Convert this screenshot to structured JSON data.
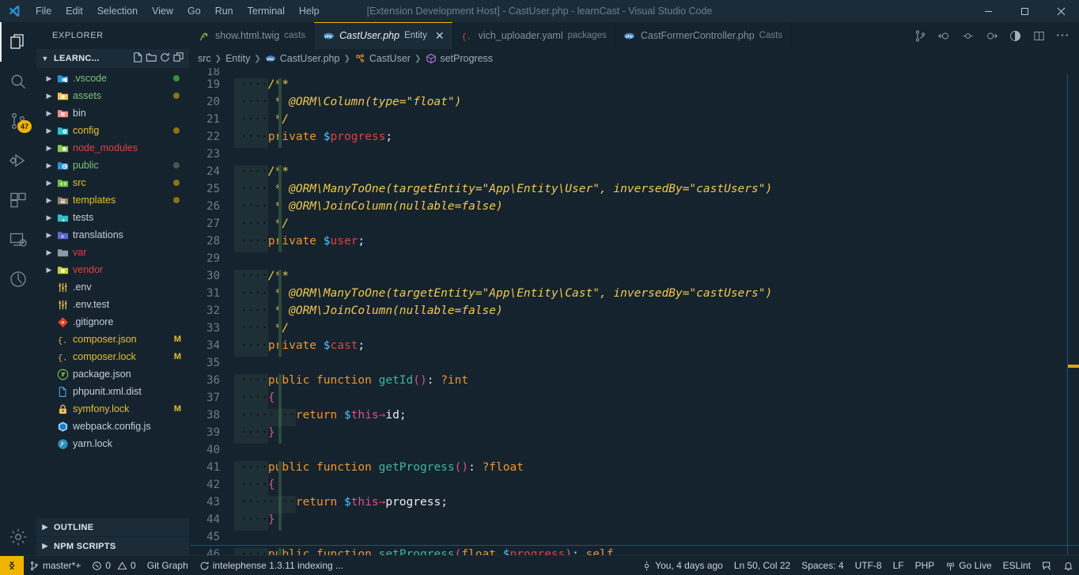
{
  "titlebar": {
    "window_title": "[Extension Development Host] - CastUser.php - learnCast - Visual Studio Code",
    "logo_name": "vscode-logo",
    "menus": [
      "File",
      "Edit",
      "Selection",
      "View",
      "Go",
      "Run",
      "Terminal",
      "Help"
    ],
    "controls": {
      "minimize": "—",
      "maximize": "❐",
      "close": "✕"
    }
  },
  "activitybar": {
    "items": [
      {
        "name": "explorer",
        "icon": "files-icon",
        "active": true,
        "badge": ""
      },
      {
        "name": "search",
        "icon": "search-icon",
        "active": false,
        "badge": ""
      },
      {
        "name": "source-control",
        "icon": "source-control-icon",
        "active": false,
        "badge": "47"
      },
      {
        "name": "run-and-debug",
        "icon": "debug-icon",
        "active": false,
        "badge": ""
      },
      {
        "name": "extensions",
        "icon": "extensions-icon",
        "active": false,
        "badge": ""
      },
      {
        "name": "remote-explorer",
        "icon": "remote-icon",
        "active": false,
        "badge": ""
      },
      {
        "name": "timeline",
        "icon": "clock-icon",
        "active": false,
        "badge": ""
      }
    ],
    "bottom": [
      {
        "name": "manage-settings",
        "icon": "gear-icon"
      }
    ]
  },
  "sidebar": {
    "title": "EXPLORER",
    "folder": "LEARNC...",
    "header_actions": [
      "new-file-icon",
      "new-folder-icon",
      "refresh-icon",
      "collapse-all-icon"
    ],
    "tree": [
      {
        "label": ".vscode",
        "type": "folder",
        "icon": "folder-vscode-icon",
        "color": "#7fbf7f",
        "indicator": "#3b8f3b",
        "mark": ""
      },
      {
        "label": "assets",
        "type": "folder",
        "icon": "folder-assets-icon",
        "color": "#7fbf7f",
        "indicator": "#8a7315",
        "mark": ""
      },
      {
        "label": "bin",
        "type": "folder",
        "icon": "folder-bin-icon",
        "color": "#c3ced7",
        "indicator": "",
        "mark": ""
      },
      {
        "label": "config",
        "type": "folder",
        "icon": "folder-config-icon",
        "color": "#e5c02a",
        "indicator": "#8a7315",
        "mark": ""
      },
      {
        "label": "node_modules",
        "type": "folder",
        "icon": "folder-node-icon",
        "color": "#e0413e",
        "indicator": "",
        "mark": ""
      },
      {
        "label": "public",
        "type": "folder",
        "icon": "folder-public-icon",
        "color": "#7fbf7f",
        "indicator": "#3f5c4a",
        "mark": ""
      },
      {
        "label": "src",
        "type": "folder",
        "icon": "folder-src-icon",
        "color": "#e5c02a",
        "indicator": "#8a7315",
        "mark": ""
      },
      {
        "label": "templates",
        "type": "folder",
        "icon": "folder-templates-icon",
        "color": "#e5c02a",
        "indicator": "#8a7315",
        "mark": ""
      },
      {
        "label": "tests",
        "type": "folder",
        "icon": "folder-tests-icon",
        "color": "#c3ced7",
        "indicator": "",
        "mark": ""
      },
      {
        "label": "translations",
        "type": "folder",
        "icon": "folder-i18n-icon",
        "color": "#c3ced7",
        "indicator": "",
        "mark": ""
      },
      {
        "label": "var",
        "type": "folder",
        "icon": "folder-var-icon",
        "color": "#e0413e",
        "indicator": "",
        "mark": ""
      },
      {
        "label": "vendor",
        "type": "folder",
        "icon": "folder-vendor-icon",
        "color": "#e0413e",
        "indicator": "",
        "mark": ""
      },
      {
        "label": ".env",
        "type": "file",
        "icon": "tune-icon",
        "color": "#c3ced7",
        "indicator": "",
        "mark": ""
      },
      {
        "label": ".env.test",
        "type": "file",
        "icon": "tune-icon",
        "color": "#c3ced7",
        "indicator": "",
        "mark": ""
      },
      {
        "label": ".gitignore",
        "type": "file",
        "icon": "git-icon",
        "color": "#c3ced7",
        "indicator": "",
        "mark": ""
      },
      {
        "label": "composer.json",
        "type": "file",
        "icon": "json-icon",
        "color": "#e5c02a",
        "indicator": "",
        "mark": "M"
      },
      {
        "label": "composer.lock",
        "type": "file",
        "icon": "json-icon",
        "color": "#e5c02a",
        "indicator": "",
        "mark": "M"
      },
      {
        "label": "package.json",
        "type": "file",
        "icon": "npm-icon",
        "color": "#c3ced7",
        "indicator": "",
        "mark": ""
      },
      {
        "label": "phpunit.xml.dist",
        "type": "file",
        "icon": "file-icon",
        "color": "#c3ced7",
        "indicator": "",
        "mark": ""
      },
      {
        "label": "symfony.lock",
        "type": "file",
        "icon": "lock-icon",
        "color": "#e5c02a",
        "indicator": "",
        "mark": "M"
      },
      {
        "label": "webpack.config.js",
        "type": "file",
        "icon": "webpack-icon",
        "color": "#c3ced7",
        "indicator": "",
        "mark": ""
      },
      {
        "label": "yarn.lock",
        "type": "file",
        "icon": "yarn-icon",
        "color": "#c3ced7",
        "indicator": "",
        "mark": ""
      }
    ],
    "bottom_sections": [
      "OUTLINE",
      "NPM SCRIPTS"
    ]
  },
  "tabs": [
    {
      "name": "show.html.twig",
      "desc": "casts",
      "icon": "twig-icon",
      "active": false,
      "closable": false
    },
    {
      "name": "CastUser.php",
      "desc": "Entity",
      "icon": "php-icon",
      "active": true,
      "closable": true
    },
    {
      "name": "vich_uploader.yaml",
      "desc": "packages",
      "icon": "yaml-icon",
      "active": false,
      "closable": false
    },
    {
      "name": "CastFormerController.php",
      "desc": "Casts",
      "icon": "php-icon",
      "active": false,
      "closable": false
    }
  ],
  "tabs_actions": [
    "split-editor-icon",
    "more-actions-icon"
  ],
  "editor_actions": [
    "source-control-icon",
    "step-back-icon",
    "step-over-icon",
    "step-forward-icon",
    "coverage-icon",
    "split-editor-icon",
    "more-actions-icon"
  ],
  "breadcrumbs": [
    {
      "label": "src",
      "icon": ""
    },
    {
      "label": "Entity",
      "icon": ""
    },
    {
      "label": "CastUser.php",
      "icon": "php-icon"
    },
    {
      "label": "CastUser",
      "icon": "class-icon"
    },
    {
      "label": "setProgress",
      "icon": "method-icon"
    }
  ],
  "code": {
    "first_partial_line": "18",
    "lines": [
      {
        "num": "19",
        "added": true,
        "indent": 1,
        "tokens": [
          {
            "t": "ind",
            "v": "····"
          },
          {
            "t": "com",
            "v": "/**"
          }
        ]
      },
      {
        "num": "20",
        "added": true,
        "indent": 1,
        "tokens": [
          {
            "t": "ind",
            "v": "····"
          },
          {
            "t": "com",
            "v": " * @ORM\\Column(type=\"float\")"
          }
        ]
      },
      {
        "num": "21",
        "added": true,
        "indent": 1,
        "tokens": [
          {
            "t": "ind",
            "v": "····"
          },
          {
            "t": "com",
            "v": " */"
          }
        ]
      },
      {
        "num": "22",
        "added": true,
        "indent": 1,
        "tokens": [
          {
            "t": "ind",
            "v": "····"
          },
          {
            "t": "kw",
            "v": "private "
          },
          {
            "t": "dollar",
            "v": "$"
          },
          {
            "t": "var",
            "v": "progress"
          },
          {
            "t": "punc",
            "v": ";"
          }
        ]
      },
      {
        "num": "23",
        "added": false,
        "indent": 0,
        "tokens": []
      },
      {
        "num": "24",
        "added": true,
        "indent": 1,
        "tokens": [
          {
            "t": "ind",
            "v": "····"
          },
          {
            "t": "com",
            "v": "/**"
          }
        ]
      },
      {
        "num": "25",
        "added": true,
        "indent": 1,
        "tokens": [
          {
            "t": "ind",
            "v": "····"
          },
          {
            "t": "com",
            "v": " * @ORM\\ManyToOne(targetEntity=\"App\\Entity\\User\", inversedBy=\"castUsers\")"
          }
        ]
      },
      {
        "num": "26",
        "added": true,
        "indent": 1,
        "tokens": [
          {
            "t": "ind",
            "v": "····"
          },
          {
            "t": "com",
            "v": " * @ORM\\JoinColumn(nullable=false)"
          }
        ]
      },
      {
        "num": "27",
        "added": true,
        "indent": 1,
        "tokens": [
          {
            "t": "ind",
            "v": "····"
          },
          {
            "t": "com",
            "v": " */"
          }
        ]
      },
      {
        "num": "28",
        "added": true,
        "indent": 1,
        "tokens": [
          {
            "t": "ind",
            "v": "····"
          },
          {
            "t": "kw",
            "v": "private "
          },
          {
            "t": "dollar",
            "v": "$"
          },
          {
            "t": "var",
            "v": "user"
          },
          {
            "t": "punc",
            "v": ";"
          }
        ]
      },
      {
        "num": "29",
        "added": false,
        "indent": 0,
        "tokens": []
      },
      {
        "num": "30",
        "added": true,
        "indent": 1,
        "tokens": [
          {
            "t": "ind",
            "v": "····"
          },
          {
            "t": "com",
            "v": "/**"
          }
        ]
      },
      {
        "num": "31",
        "added": true,
        "indent": 1,
        "tokens": [
          {
            "t": "ind",
            "v": "····"
          },
          {
            "t": "com",
            "v": " * @ORM\\ManyToOne(targetEntity=\"App\\Entity\\Cast\", inversedBy=\"castUsers\")"
          }
        ]
      },
      {
        "num": "32",
        "added": true,
        "indent": 1,
        "tokens": [
          {
            "t": "ind",
            "v": "····"
          },
          {
            "t": "com",
            "v": " * @ORM\\JoinColumn(nullable=false)"
          }
        ]
      },
      {
        "num": "33",
        "added": true,
        "indent": 1,
        "tokens": [
          {
            "t": "ind",
            "v": "····"
          },
          {
            "t": "com",
            "v": " */"
          }
        ]
      },
      {
        "num": "34",
        "added": true,
        "indent": 1,
        "tokens": [
          {
            "t": "ind",
            "v": "····"
          },
          {
            "t": "kw",
            "v": "private "
          },
          {
            "t": "dollar",
            "v": "$"
          },
          {
            "t": "var",
            "v": "cast"
          },
          {
            "t": "punc",
            "v": ";"
          }
        ]
      },
      {
        "num": "35",
        "added": false,
        "indent": 0,
        "tokens": []
      },
      {
        "num": "36",
        "added": true,
        "indent": 1,
        "tokens": [
          {
            "t": "ind",
            "v": "····"
          },
          {
            "t": "kw",
            "v": "public function "
          },
          {
            "t": "fn",
            "v": "getId"
          },
          {
            "t": "paren",
            "v": "()"
          },
          {
            "t": "punc",
            "v": ": "
          },
          {
            "t": "type",
            "v": "?int"
          }
        ]
      },
      {
        "num": "37",
        "added": true,
        "indent": 1,
        "tokens": [
          {
            "t": "ind",
            "v": "····"
          },
          {
            "t": "brace",
            "v": "{"
          }
        ]
      },
      {
        "num": "38",
        "added": true,
        "indent": 2,
        "tokens": [
          {
            "t": "ind",
            "v": "····"
          },
          {
            "t": "ind",
            "v": "····"
          },
          {
            "t": "kw",
            "v": "return "
          },
          {
            "t": "dollar",
            "v": "$"
          },
          {
            "t": "this",
            "v": "this"
          },
          {
            "t": "arrow",
            "v": "→"
          },
          {
            "t": "prop",
            "v": "id"
          },
          {
            "t": "punc",
            "v": ";"
          }
        ]
      },
      {
        "num": "39",
        "added": true,
        "indent": 1,
        "tokens": [
          {
            "t": "ind",
            "v": "····"
          },
          {
            "t": "brace",
            "v": "}"
          }
        ]
      },
      {
        "num": "40",
        "added": false,
        "indent": 0,
        "tokens": []
      },
      {
        "num": "41",
        "added": true,
        "indent": 1,
        "tokens": [
          {
            "t": "ind",
            "v": "····"
          },
          {
            "t": "kw",
            "v": "public function "
          },
          {
            "t": "fn",
            "v": "getProgress"
          },
          {
            "t": "paren",
            "v": "()"
          },
          {
            "t": "punc",
            "v": ": "
          },
          {
            "t": "type",
            "v": "?float"
          }
        ]
      },
      {
        "num": "42",
        "added": true,
        "indent": 1,
        "tokens": [
          {
            "t": "ind",
            "v": "····"
          },
          {
            "t": "brace",
            "v": "{"
          }
        ]
      },
      {
        "num": "43",
        "added": true,
        "indent": 2,
        "tokens": [
          {
            "t": "ind",
            "v": "····"
          },
          {
            "t": "ind",
            "v": "····"
          },
          {
            "t": "kw",
            "v": "return "
          },
          {
            "t": "dollar",
            "v": "$"
          },
          {
            "t": "this",
            "v": "this"
          },
          {
            "t": "arrow",
            "v": "→"
          },
          {
            "t": "prop",
            "v": "progress"
          },
          {
            "t": "punc",
            "v": ";"
          }
        ]
      },
      {
        "num": "44",
        "added": true,
        "indent": 1,
        "tokens": [
          {
            "t": "ind",
            "v": "····"
          },
          {
            "t": "brace",
            "v": "}"
          }
        ]
      },
      {
        "num": "45",
        "added": false,
        "indent": 0,
        "tokens": []
      },
      {
        "num": "46",
        "added": true,
        "indent": 1,
        "tokens": [
          {
            "t": "ind",
            "v": "····"
          },
          {
            "t": "kw",
            "v": "public function "
          },
          {
            "t": "fn",
            "v": "setProgress"
          },
          {
            "t": "paren",
            "v": "("
          },
          {
            "t": "type",
            "v": "float "
          },
          {
            "t": "dollar",
            "v": "$"
          },
          {
            "t": "var",
            "v": "progress"
          },
          {
            "t": "paren",
            "v": ")"
          },
          {
            "t": "punc",
            "v": ": "
          },
          {
            "t": "type",
            "v": "self"
          }
        ]
      }
    ]
  },
  "statusbar": {
    "remote_icon": "remote-window-icon",
    "left": [
      {
        "label": "master*+",
        "icon": "git-branch-icon"
      },
      {
        "label": "0",
        "icon": "error-icon",
        "second_label": "0",
        "second_icon": "warning-icon"
      },
      {
        "label": "Git Graph",
        "icon": ""
      },
      {
        "label": "intelephense 1.3.11 indexing ...",
        "icon": "sync-icon"
      }
    ],
    "right": [
      {
        "label": "You, 4 days ago",
        "icon": "git-commit-icon"
      },
      {
        "label": "Ln 50, Col 22",
        "icon": ""
      },
      {
        "label": "Spaces: 4",
        "icon": ""
      },
      {
        "label": "UTF-8",
        "icon": ""
      },
      {
        "label": "LF",
        "icon": ""
      },
      {
        "label": "PHP",
        "icon": ""
      },
      {
        "label": "Go Live",
        "icon": "broadcast-icon"
      },
      {
        "label": "ESLint",
        "icon": ""
      },
      {
        "label": "",
        "icon": "feedback-icon"
      },
      {
        "label": "",
        "icon": "bell-icon"
      }
    ]
  }
}
